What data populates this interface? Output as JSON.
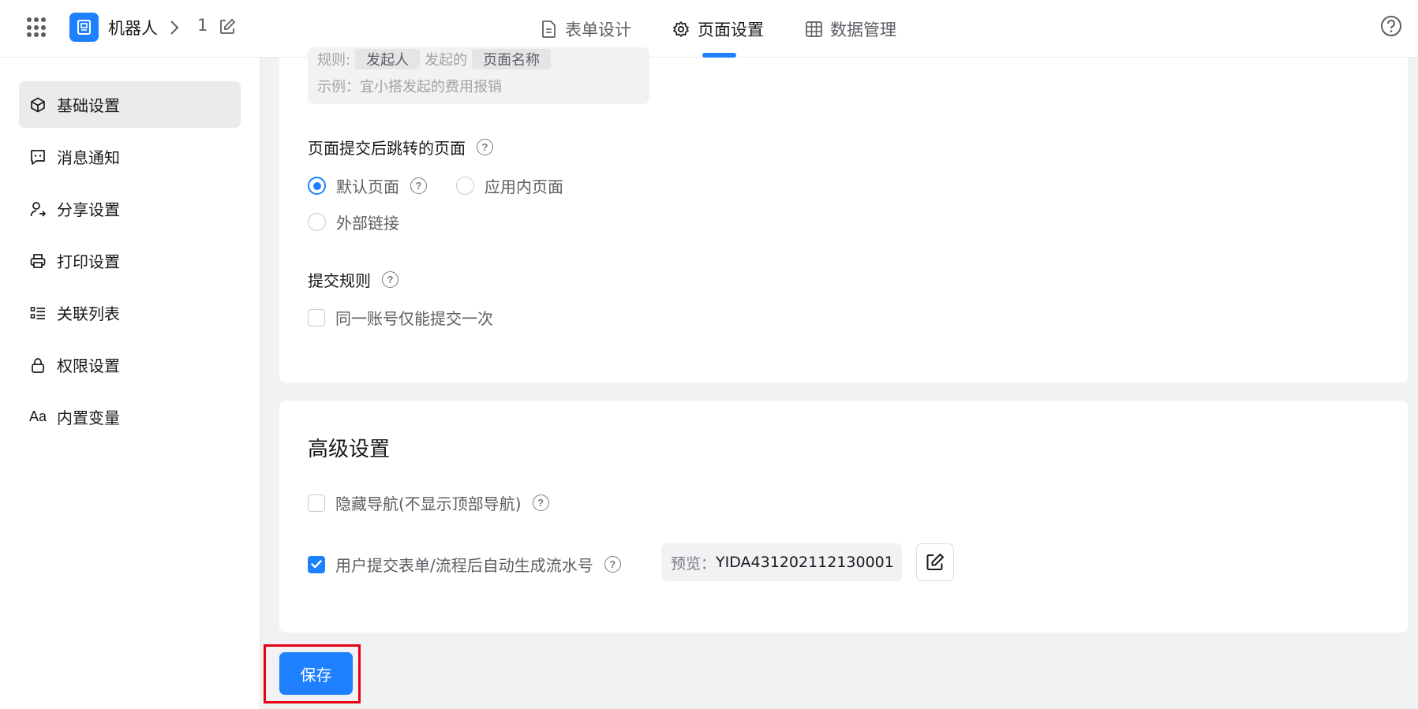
{
  "header": {
    "app_name": "机器人",
    "page_name": "1",
    "tabs": [
      {
        "label": "表单设计",
        "icon": "file-text-icon"
      },
      {
        "label": "页面设置",
        "icon": "gear-icon",
        "active": true
      },
      {
        "label": "数据管理",
        "icon": "table-grid-icon"
      }
    ]
  },
  "sidebar": {
    "items": [
      {
        "label": "基础设置",
        "icon": "cube-icon",
        "active": true
      },
      {
        "label": "消息通知",
        "icon": "message-icon"
      },
      {
        "label": "分享设置",
        "icon": "user-share-icon"
      },
      {
        "label": "打印设置",
        "icon": "printer-icon"
      },
      {
        "label": "关联列表",
        "icon": "list-icon"
      },
      {
        "label": "权限设置",
        "icon": "lock-icon"
      },
      {
        "label": "内置变量",
        "icon": "text-aa-icon"
      }
    ]
  },
  "basic": {
    "rule_prefix": "规则:",
    "rule_chip1": "发起人",
    "rule_mid": "发起的",
    "rule_chip2": "页面名称",
    "example": "示例：宜小搭发起的费用报销",
    "redirect_label": "页面提交后跳转的页面",
    "redirect_options": [
      "默认页面",
      "应用内页面",
      "外部链接"
    ],
    "submit_rule_label": "提交规则",
    "submit_once": "同一账号仅能提交一次"
  },
  "advanced": {
    "title": "高级设置",
    "hide_nav": "隐藏导航(不显示顶部导航)",
    "auto_serial": "用户提交表单/流程后自动生成流水号",
    "preview_label": "预览：",
    "preview_value": "YIDA431202112130001"
  },
  "footer": {
    "save_label": "保存"
  },
  "colors": {
    "primary": "#1e80ff",
    "highlight": "#e60012"
  }
}
